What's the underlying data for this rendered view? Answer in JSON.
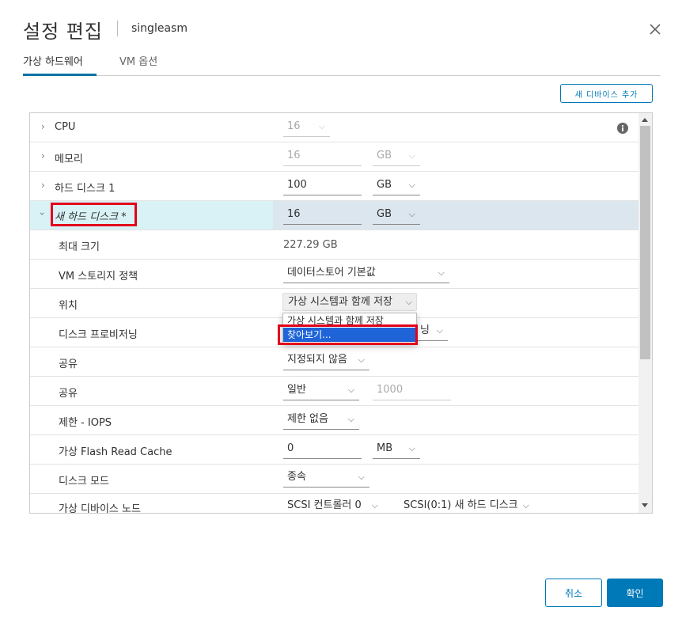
{
  "dialog": {
    "title": "설정 편집",
    "subtitle": "singleasm"
  },
  "tabs": [
    {
      "label": "가상 하드웨어",
      "active": true
    },
    {
      "label": "VM 옵션",
      "active": false
    }
  ],
  "toolbar": {
    "add_device_label": "새 디바이스 추가"
  },
  "rows": {
    "cpu": {
      "label": "CPU",
      "value": "16"
    },
    "memory": {
      "label": "메모리",
      "value": "16",
      "unit": "GB"
    },
    "hdd1": {
      "label": "하드 디스크 1",
      "value": "100",
      "unit": "GB"
    },
    "new_hdd": {
      "label": "새 하드 디스크 *",
      "value": "16",
      "unit": "GB"
    },
    "max_size": {
      "label": "최대 크기",
      "value": "227.29 GB"
    },
    "storage_policy": {
      "label": "VM 스토리지 정책",
      "value": "데이터스토어 기본값"
    },
    "location": {
      "label": "위치",
      "value": "가상 시스템과 함께 저장"
    },
    "provisioning": {
      "label": "디스크 프로비저닝",
      "value_tail": "닝"
    },
    "sharing": {
      "label": "공유",
      "value": "지정되지 않음"
    },
    "shares": {
      "label": "공유",
      "value": "일반",
      "number": "1000"
    },
    "limit_iops": {
      "label": "제한 - IOPS",
      "value": "제한 없음"
    },
    "flash_cache": {
      "label": "가상 Flash Read Cache",
      "value": "0",
      "unit": "MB"
    },
    "disk_mode": {
      "label": "디스크 모드",
      "value": "종속"
    },
    "device_node": {
      "label": "가상 디바이스 노드",
      "controller": "SCSI 컨트롤러 0",
      "node": "SCSI(0:1) 새 하드 디스크"
    }
  },
  "location_dropdown": {
    "options": [
      "가상 시스템과 함께 저장",
      "찾아보기..."
    ],
    "highlighted": "찾아보기..."
  },
  "footer": {
    "cancel_label": "취소",
    "ok_label": "확인"
  },
  "colors": {
    "accent": "#0079b8",
    "highlight_row": "#d8f2f5",
    "selected_option": "#1e64d8",
    "annotation": "#e3001b"
  }
}
